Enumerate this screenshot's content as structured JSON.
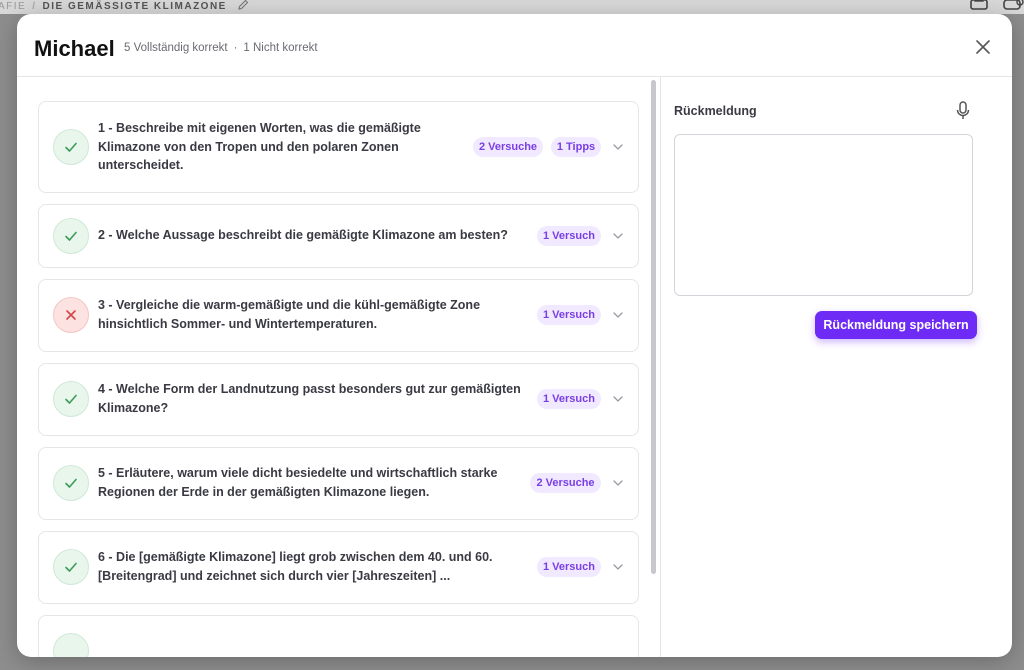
{
  "background": {
    "breadcrumb_prev": "AFIE",
    "breadcrumb_sep": "/",
    "breadcrumb_current": "DIE GEMÄSSIGTE KLIMAZONE"
  },
  "modal": {
    "student_name": "Michael",
    "summary_correct": "5 Vollständig korrekt",
    "summary_dot": "·",
    "summary_incorrect": "1 Nicht korrekt"
  },
  "questions": [
    {
      "text": "1 - Beschreibe mit eigenen Worten, was die gemäßigte Klimazone von den Tropen und den polaren Zonen unterscheidet.",
      "status": "correct",
      "badges": [
        "2 Versuche",
        "1 Tipps"
      ]
    },
    {
      "text": "2 - Welche Aussage beschreibt die gemäßigte Klimazone am besten?",
      "status": "correct",
      "badges": [
        "1 Versuch"
      ]
    },
    {
      "text": "3 - Vergleiche die warm-gemäßigte und die kühl-gemäßigte Zone hinsichtlich Sommer- und Wintertemperaturen.",
      "status": "incorrect",
      "badges": [
        "1 Versuch"
      ]
    },
    {
      "text": "4 - Welche Form der Landnutzung passt besonders gut zur gemäßigten Klimazone?",
      "status": "correct",
      "badges": [
        "1 Versuch"
      ]
    },
    {
      "text": "5 - Erläutere, warum viele dicht besiedelte und wirtschaftlich starke Regionen der Erde in der gemäßigten Klimazone liegen.",
      "status": "correct",
      "badges": [
        "2 Versuche"
      ]
    },
    {
      "text": "6 - Die [gemäßigte Klimazone] liegt grob zwischen dem 40. und 60. [Breitengrad] und zeichnet sich durch vier [Jahreszeiten] ...",
      "status": "correct",
      "badges": [
        "1 Versuch"
      ]
    }
  ],
  "feedback": {
    "label": "Rückmeldung",
    "value": "",
    "save_label": "Rückmeldung speichern"
  },
  "colors": {
    "accent": "#6d2bf5",
    "badge_bg": "#f1e9ff",
    "badge_text": "#7a3ee6",
    "correct": "#3f9a5a",
    "incorrect": "#d64545"
  }
}
